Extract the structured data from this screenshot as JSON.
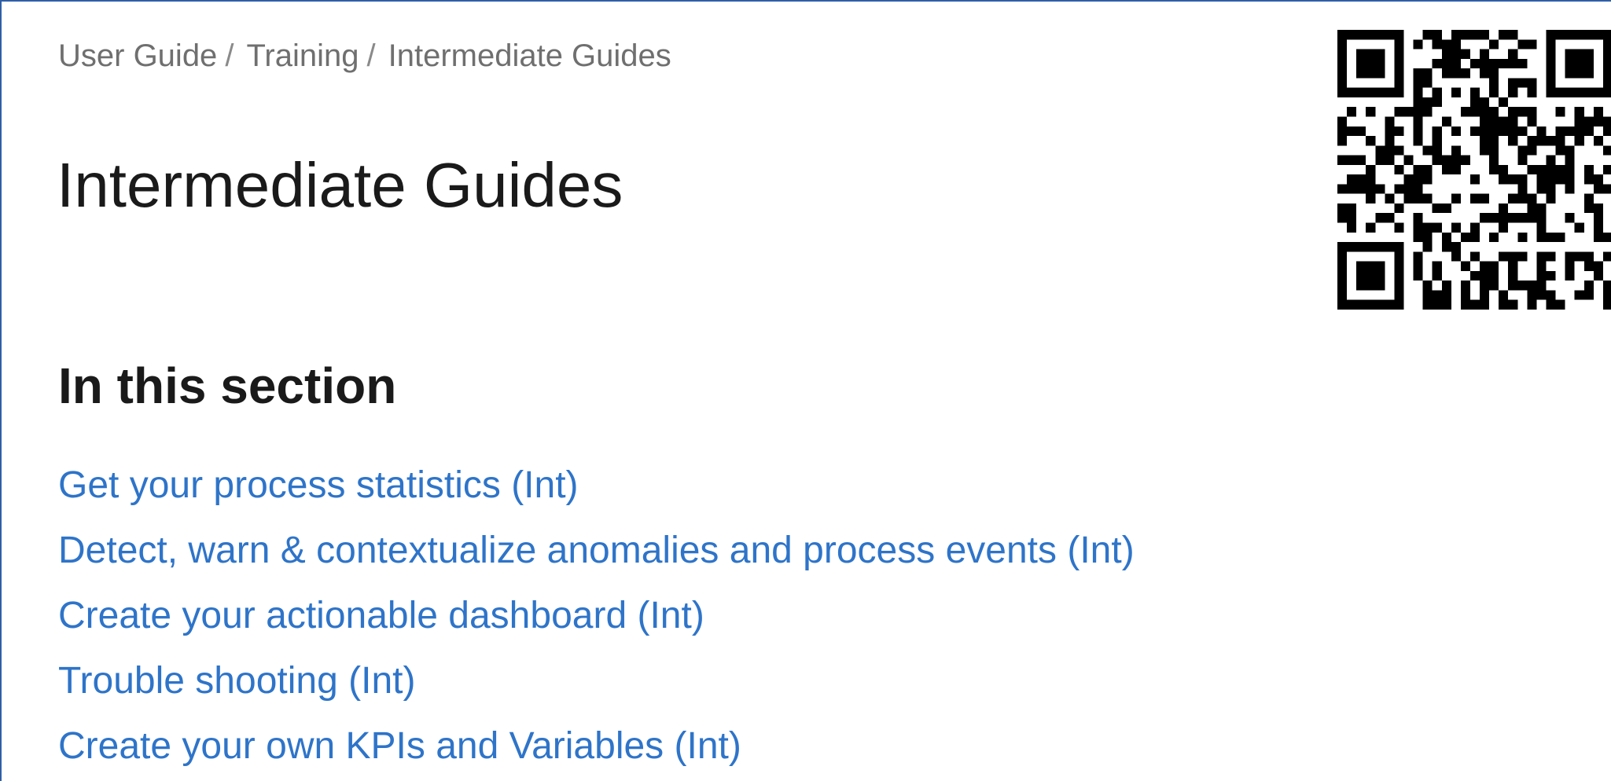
{
  "breadcrumb": {
    "items": [
      "User Guide",
      "Training",
      "Intermediate Guides"
    ],
    "separator": "/"
  },
  "page": {
    "title": "Intermediate Guides"
  },
  "section": {
    "heading": "In this section",
    "links": [
      "Get your process statistics (Int)",
      "Detect, warn & contextualize anomalies and process events (Int)",
      "Create your actionable dashboard (Int)",
      "Trouble shooting (Int)",
      "Create your own KPIs and Variables (Int)"
    ]
  },
  "colors": {
    "link": "#2e74c9",
    "breadcrumb": "#6f6f6f",
    "text": "#1a1a1a",
    "frame_border": "#2f5fa8"
  },
  "icons": {
    "qr": "qr-code-icon"
  }
}
